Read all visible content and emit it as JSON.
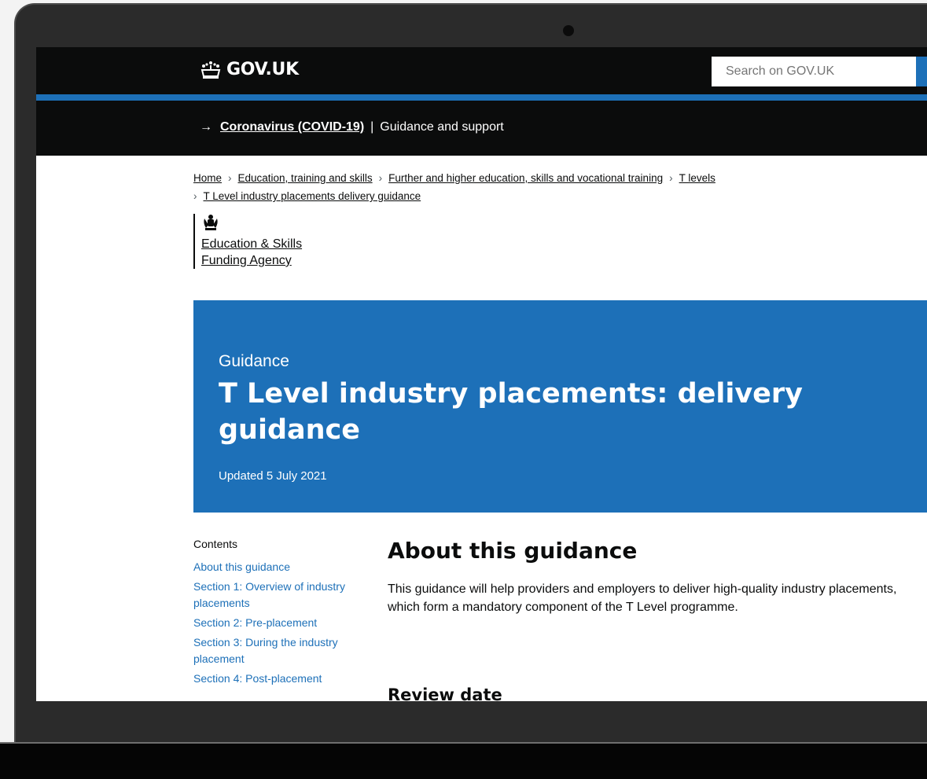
{
  "header": {
    "logo_text": "GOV.UK",
    "search_placeholder": "Search on GOV.UK"
  },
  "covid_banner": {
    "arrow": "→",
    "link": "Coronavirus (COVID-19)",
    "separator": "|",
    "text": "Guidance and support"
  },
  "breadcrumbs": {
    "items": [
      "Home",
      "Education, training and skills",
      "Further and higher education, skills and vocational training",
      "T levels",
      "T Level industry placements delivery guidance"
    ],
    "chevron": "›"
  },
  "organisation": {
    "line1": "Education & Skills",
    "line2": "Funding Agency"
  },
  "title_band": {
    "kicker": "Guidance",
    "title": "T Level industry placements: delivery guidance",
    "updated": "Updated 5 July 2021"
  },
  "contents": {
    "title": "Contents",
    "items": [
      "About this guidance",
      "Section 1: Overview of industry placements",
      "Section 2: Pre-placement",
      "Section 3: During the industry placement",
      "Section 4: Post-placement"
    ]
  },
  "main": {
    "heading": "About this guidance",
    "paragraph": "This guidance will help providers and employers to deliver high-quality industry placements, which form a mandatory component of the T Level programme.",
    "subheading": "Review date"
  },
  "colors": {
    "header_bg": "#0b0c0c",
    "brand_blue": "#1d70b8",
    "laptop_frame": "#2b2b2b"
  }
}
